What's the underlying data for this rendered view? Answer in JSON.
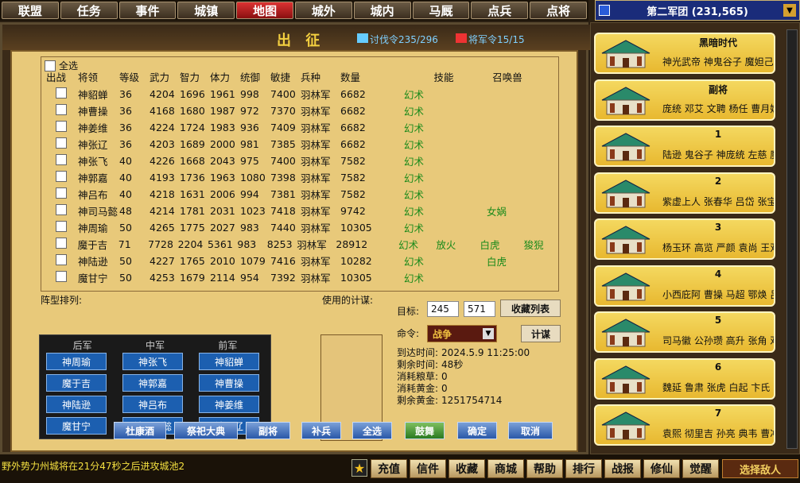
{
  "nav": {
    "tabs": [
      "联盟",
      "任务",
      "事件",
      "城镇",
      "地图",
      "城外",
      "城内",
      "马厩",
      "点兵",
      "点将"
    ],
    "active_index": 4
  },
  "army": {
    "label": "第二军团 (231,565)"
  },
  "dialog": {
    "title": "出 征",
    "token1": "讨伐令235/296",
    "token2": "将军令15/15",
    "select_all": "全选",
    "headers": [
      "出战",
      "将领",
      "等级",
      "武力",
      "智力",
      "体力",
      "统御",
      "敏捷",
      "兵种",
      "数量",
      "技能",
      "召唤兽"
    ],
    "rows": [
      [
        "神貂蝉",
        "36",
        "4204",
        "1696",
        "1961",
        "998",
        "7400",
        "羽林军",
        "6682",
        "幻术",
        "",
        ""
      ],
      [
        "神曹操",
        "36",
        "4168",
        "1680",
        "1987",
        "972",
        "7370",
        "羽林军",
        "6682",
        "幻术",
        "",
        ""
      ],
      [
        "神姜维",
        "36",
        "4224",
        "1724",
        "1983",
        "936",
        "7409",
        "羽林军",
        "6682",
        "幻术",
        "",
        ""
      ],
      [
        "神张辽",
        "36",
        "4203",
        "1689",
        "2000",
        "981",
        "7385",
        "羽林军",
        "6682",
        "幻术",
        "",
        ""
      ],
      [
        "神张飞",
        "40",
        "4226",
        "1668",
        "2043",
        "975",
        "7400",
        "羽林军",
        "7582",
        "幻术",
        "",
        ""
      ],
      [
        "神郭嘉",
        "40",
        "4193",
        "1736",
        "1963",
        "1080",
        "7398",
        "羽林军",
        "7582",
        "幻术",
        "",
        ""
      ],
      [
        "神吕布",
        "40",
        "4218",
        "1631",
        "2006",
        "994",
        "7381",
        "羽林军",
        "7582",
        "幻术",
        "",
        ""
      ],
      [
        "神司马懿",
        "48",
        "4214",
        "1781",
        "2031",
        "1023",
        "7418",
        "羽林军",
        "9742",
        "幻术",
        "",
        "女娲"
      ],
      [
        "神周瑜",
        "50",
        "4265",
        "1775",
        "2027",
        "983",
        "7440",
        "羽林军",
        "10305",
        "幻术",
        "",
        ""
      ],
      [
        "魔于吉",
        "71",
        "7728",
        "2204",
        "5361",
        "983",
        "8253",
        "羽林军",
        "28912",
        "幻术",
        "放火",
        "白虎",
        "狻猊"
      ],
      [
        "神陆逊",
        "50",
        "4227",
        "1765",
        "2010",
        "1079",
        "7416",
        "羽林军",
        "10282",
        "幻术",
        "",
        "白虎"
      ],
      [
        "魔甘宁",
        "50",
        "4253",
        "1679",
        "2114",
        "954",
        "7392",
        "羽林军",
        "10305",
        "幻术",
        "",
        ""
      ]
    ],
    "formation": {
      "label": "阵型排列:",
      "cols": [
        "后军",
        "中军",
        "前军"
      ],
      "rear": [
        "神周瑜",
        "魔于吉",
        "神陆逊",
        "魔甘宁"
      ],
      "mid": [
        "神张飞",
        "神郭嘉",
        "神吕布",
        "神司马懿"
      ],
      "front": [
        "神貂蝉",
        "神曹操",
        "神姜维",
        "神张辽"
      ]
    },
    "plans_label": "使用的计谋:",
    "target_label": "目标:",
    "target_x": "245",
    "target_y": "571",
    "fav_btn": "收藏列表",
    "cmd_label": "命令:",
    "cmd_value": "战争",
    "calc_btn": "计谋",
    "info": [
      [
        "到达时间:",
        "2024.5.9  11:25:00"
      ],
      [
        "剩余时间:",
        "48秒"
      ],
      [
        "消耗粮草:",
        "0"
      ],
      [
        "消耗黄金:",
        "0"
      ],
      [
        "剩余黄金:",
        "1251754714"
      ]
    ],
    "actions": [
      "杜康酒",
      "祭祀大典",
      "副将",
      "补兵",
      "全选",
      "鼓舞",
      "确定",
      "取消"
    ]
  },
  "side": {
    "cards": [
      {
        "title": "黑暗时代",
        "names": "神光武帝 神鬼谷子 魔妲己"
      },
      {
        "title": "副将",
        "names": "庞统 邓艾 文聘 杨任 曹月娥"
      },
      {
        "title": "1",
        "names": "陆逊 鬼谷子 神庞统 左慈 魔"
      },
      {
        "title": "2",
        "names": "紫虚上人 张春华 吕岱 张宝"
      },
      {
        "title": "3",
        "names": "杨玉环 高览 严颜 袁尚 王双"
      },
      {
        "title": "4",
        "names": "小西庇阿 曹操 马超 鄂焕 吕"
      },
      {
        "title": "5",
        "names": "司马徽 公孙瓒 高升 张角 邓"
      },
      {
        "title": "6",
        "names": "魏延 鲁肃 张虎 白起 卞氏 "
      },
      {
        "title": "7",
        "names": "袁熙 彻里吉 孙亮 典韦 曹冲"
      }
    ]
  },
  "bottom": {
    "ticker": "野外势力州城将在21分47秒之后进攻城池2",
    "buttons": [
      "充值",
      "信件",
      "收藏",
      "商城",
      "帮助",
      "排行",
      "战报",
      "修仙",
      "觉醒"
    ],
    "choose": "选择敌人"
  },
  "colors": {
    "accent": "#f4d040",
    "blue_btn": "#1c5fb0",
    "skill_green": "#1a8a1a"
  }
}
